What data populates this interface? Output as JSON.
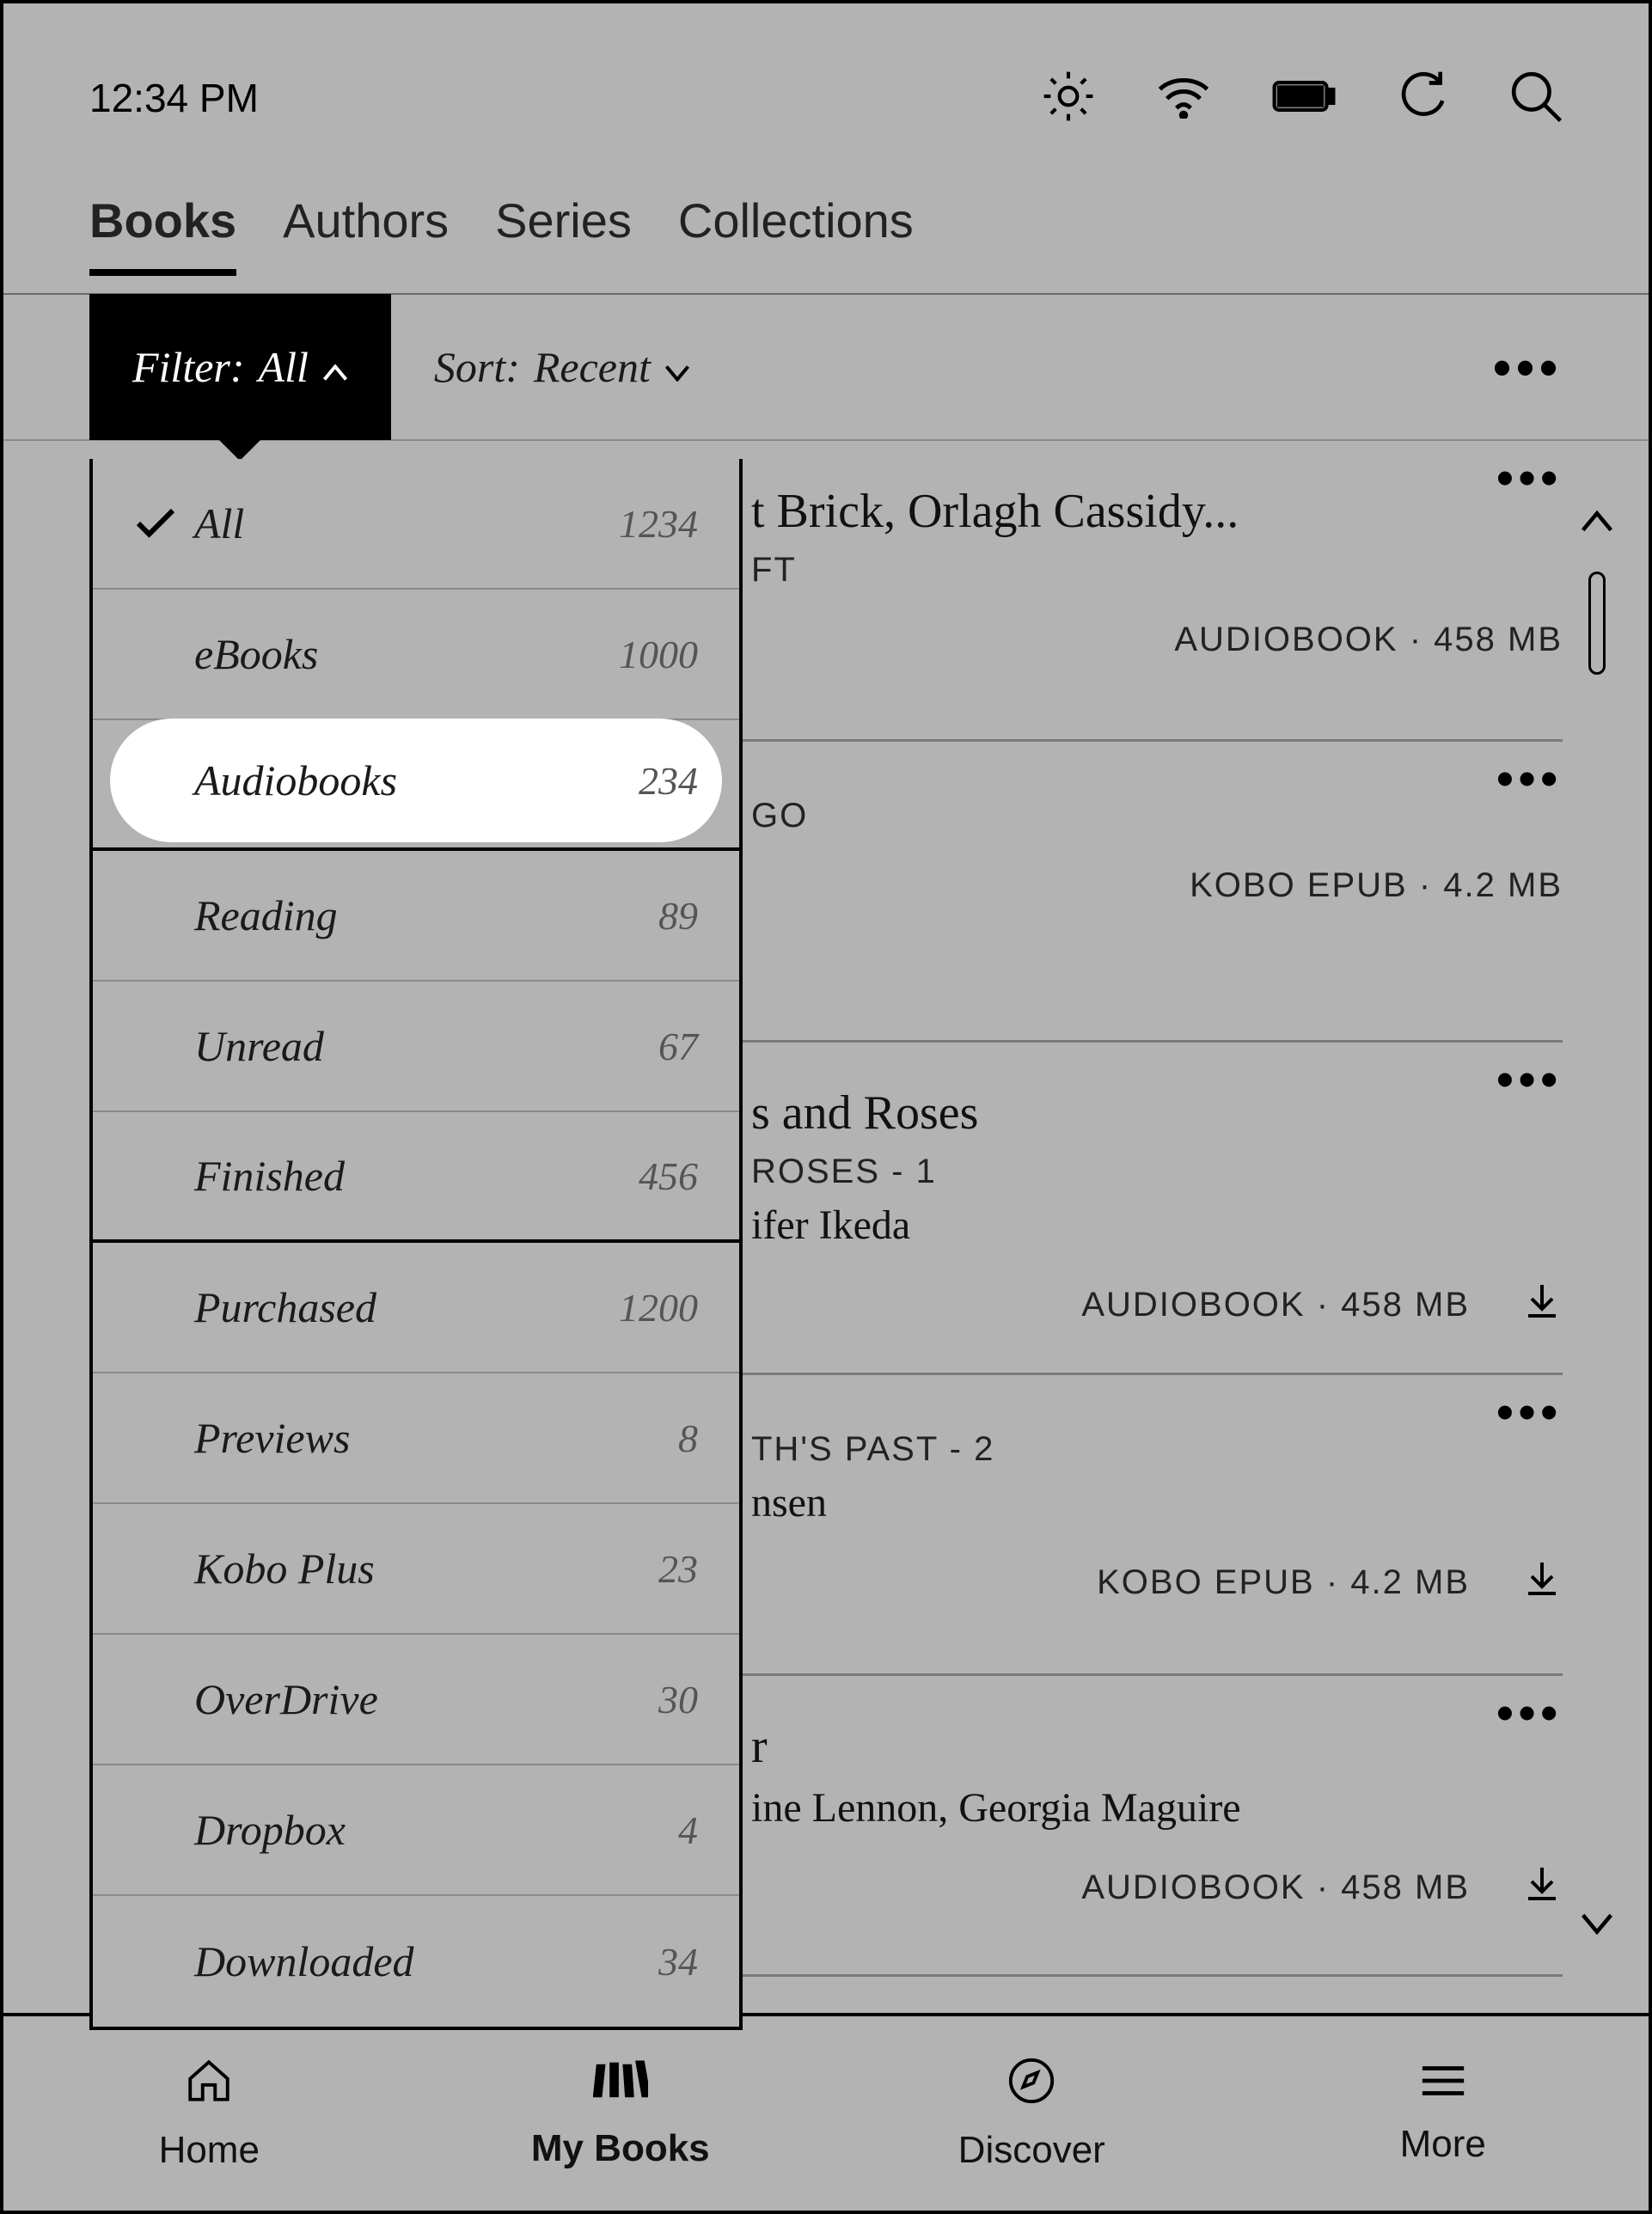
{
  "status": {
    "time": "12:34 PM"
  },
  "tabs": [
    {
      "label": "Books",
      "active": true
    },
    {
      "label": "Authors",
      "active": false
    },
    {
      "label": "Series",
      "active": false
    },
    {
      "label": "Collections",
      "active": false
    }
  ],
  "filter": {
    "prefix": "Filter: ",
    "value": "All"
  },
  "sort": {
    "prefix": "Sort: ",
    "value": "Recent"
  },
  "filter_options": [
    {
      "label": "All",
      "count": "1234",
      "checked": true,
      "section_end": false
    },
    {
      "label": "eBooks",
      "count": "1000",
      "checked": false,
      "section_end": false
    },
    {
      "label": "Audiobooks",
      "count": "234",
      "checked": false,
      "section_end": true,
      "highlight": true
    },
    {
      "label": "Reading",
      "count": "89",
      "checked": false,
      "section_end": false
    },
    {
      "label": "Unread",
      "count": "67",
      "checked": false,
      "section_end": false
    },
    {
      "label": "Finished",
      "count": "456",
      "checked": false,
      "section_end": true
    },
    {
      "label": "Purchased",
      "count": "1200",
      "checked": false,
      "section_end": false
    },
    {
      "label": "Previews",
      "count": "8",
      "checked": false,
      "section_end": false
    },
    {
      "label": "Kobo Plus",
      "count": "23",
      "checked": false,
      "section_end": false
    },
    {
      "label": "OverDrive",
      "count": "30",
      "checked": false,
      "section_end": false
    },
    {
      "label": "Dropbox",
      "count": "4",
      "checked": false,
      "section_end": false
    },
    {
      "label": "Downloaded",
      "count": "34",
      "checked": false,
      "section_end": false
    }
  ],
  "books": [
    {
      "title_fragment": "t Brick, Orlagh Cassidy...",
      "series_fragment": "FT",
      "meta": "AUDIOBOOK · 458 MB"
    },
    {
      "series_fragment": "GO",
      "meta": "KOBO EPUB · 4.2 MB"
    },
    {
      "title_fragment": "s and Roses",
      "series_fragment": "ROSES - 1",
      "author_fragment": "ifer Ikeda",
      "meta": "AUDIOBOOK · 458 MB",
      "download": true
    },
    {
      "series_fragment": "TH'S PAST - 2",
      "author_fragment": "nsen",
      "meta": "KOBO EPUB · 4.2 MB",
      "download": true
    },
    {
      "title_fragment": "r",
      "author_fragment": "ine Lennon, Georgia Maguire",
      "meta": "AUDIOBOOK · 458 MB",
      "download": true
    }
  ],
  "nav": [
    {
      "label": "Home",
      "icon": "home",
      "active": false
    },
    {
      "label": "My Books",
      "icon": "mybooks",
      "active": true
    },
    {
      "label": "Discover",
      "icon": "compass",
      "active": false
    },
    {
      "label": "More",
      "icon": "menu",
      "active": false
    }
  ]
}
